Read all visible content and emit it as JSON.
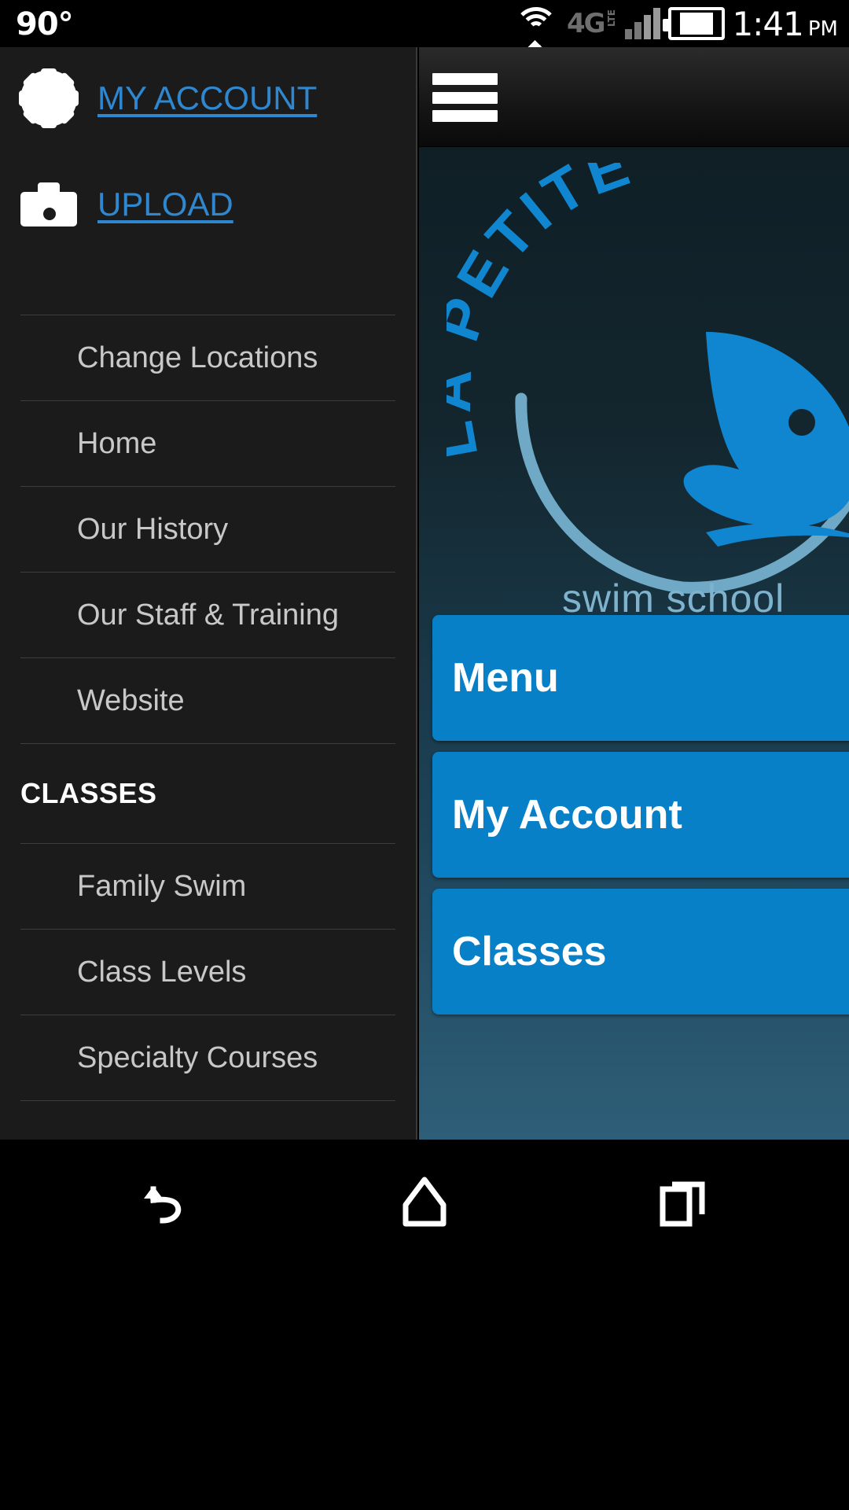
{
  "status_bar": {
    "temperature": "90°",
    "wifi_icon": "wifi-icon",
    "data_arrows_icon": "data-transfer-arrows-icon",
    "network_type": "4G",
    "network_suffix": "LTE",
    "signal_icon": "cellular-signal-icon",
    "battery_icon": "battery-full-icon",
    "time": "1:41",
    "am_pm": "PM"
  },
  "drawer": {
    "quick_links": [
      {
        "label": "MY ACCOUNT",
        "icon": "gear-icon"
      },
      {
        "label": "UPLOAD",
        "icon": "camera-icon"
      }
    ],
    "nav_items": [
      {
        "label": "Change Locations"
      },
      {
        "label": "Home"
      },
      {
        "label": "Our History"
      },
      {
        "label": "Our Staff & Training"
      },
      {
        "label": "Website"
      }
    ],
    "section_title": "CLASSES",
    "class_items": [
      {
        "label": "Family Swim"
      },
      {
        "label": "Class Levels"
      },
      {
        "label": "Specialty Courses"
      }
    ]
  },
  "content": {
    "app_bar": {
      "menu_icon": "hamburger-menu-icon"
    },
    "logo": {
      "arc_text": "LA PETITE",
      "subtitle": "swim school",
      "mark": "whale-logo-icon"
    },
    "buttons": [
      {
        "label": "Menu",
        "name": "menu"
      },
      {
        "label": "My Account",
        "name": "my-account"
      },
      {
        "label": "Classes",
        "name": "classes"
      }
    ]
  },
  "navbar": {
    "back": "back-icon",
    "home": "home-icon",
    "recents": "recent-apps-icon"
  },
  "colors": {
    "accent_blue": "#0780c8",
    "link_blue": "#2f87cf",
    "logo_light_blue": "#7fb3cd",
    "drawer_bg": "#1b1b1b",
    "panel_top": "#0e1c23",
    "panel_bottom": "#2e5f78"
  }
}
